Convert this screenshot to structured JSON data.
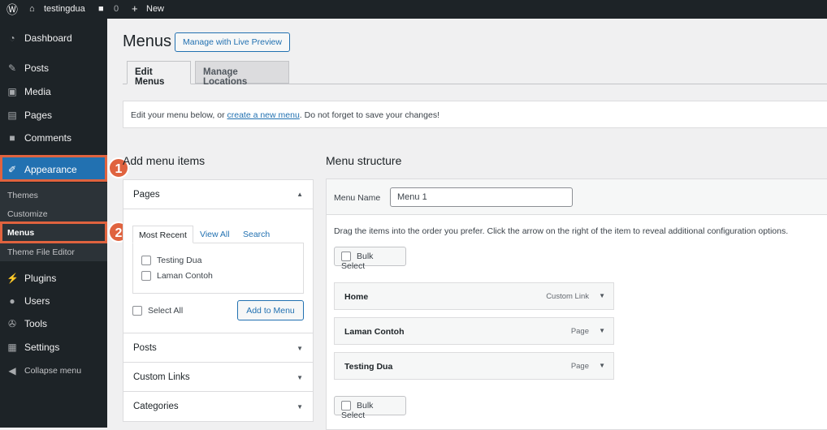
{
  "topbar": {
    "site": "testingdua",
    "comments": "0",
    "new": "New"
  },
  "sidebar": {
    "items": [
      "Dashboard",
      "Posts",
      "Media",
      "Pages",
      "Comments",
      "Appearance",
      "Plugins",
      "Users",
      "Tools",
      "Settings",
      "Collapse menu"
    ],
    "submenu": [
      "Themes",
      "Customize",
      "Menus",
      "Theme File Editor"
    ]
  },
  "annotations": [
    "1",
    "2"
  ],
  "page": {
    "title": "Menus",
    "live_preview": "Manage with Live Preview",
    "tabs": [
      "Edit Menus",
      "Manage Locations"
    ],
    "notice_pre": "Edit your menu below, or ",
    "notice_link": "create a new menu",
    "notice_post": ". Do not forget to save your changes!"
  },
  "add_items": {
    "heading": "Add menu items",
    "pages": "Pages",
    "tabs": [
      "Most Recent",
      "View All",
      "Search"
    ],
    "pages_list": [
      "Testing Dua",
      "Laman Contoh"
    ],
    "select_all": "Select All",
    "add_button": "Add to Menu",
    "sections": [
      "Posts",
      "Custom Links",
      "Categories"
    ]
  },
  "structure": {
    "heading": "Menu structure",
    "name_label": "Menu Name",
    "name_value": "Menu 1",
    "instructions": "Drag the items into the order you prefer. Click the arrow on the right of the item to reveal additional configuration options.",
    "bulk_select": "Bulk Select",
    "items": [
      {
        "label": "Home",
        "type": "Custom Link"
      },
      {
        "label": "Laman Contoh",
        "type": "Page"
      },
      {
        "label": "Testing Dua",
        "type": "Page"
      }
    ]
  },
  "colors": {
    "accent": "#2271b1",
    "annotation": "#e0633f",
    "sidebar": "#1d2327"
  }
}
